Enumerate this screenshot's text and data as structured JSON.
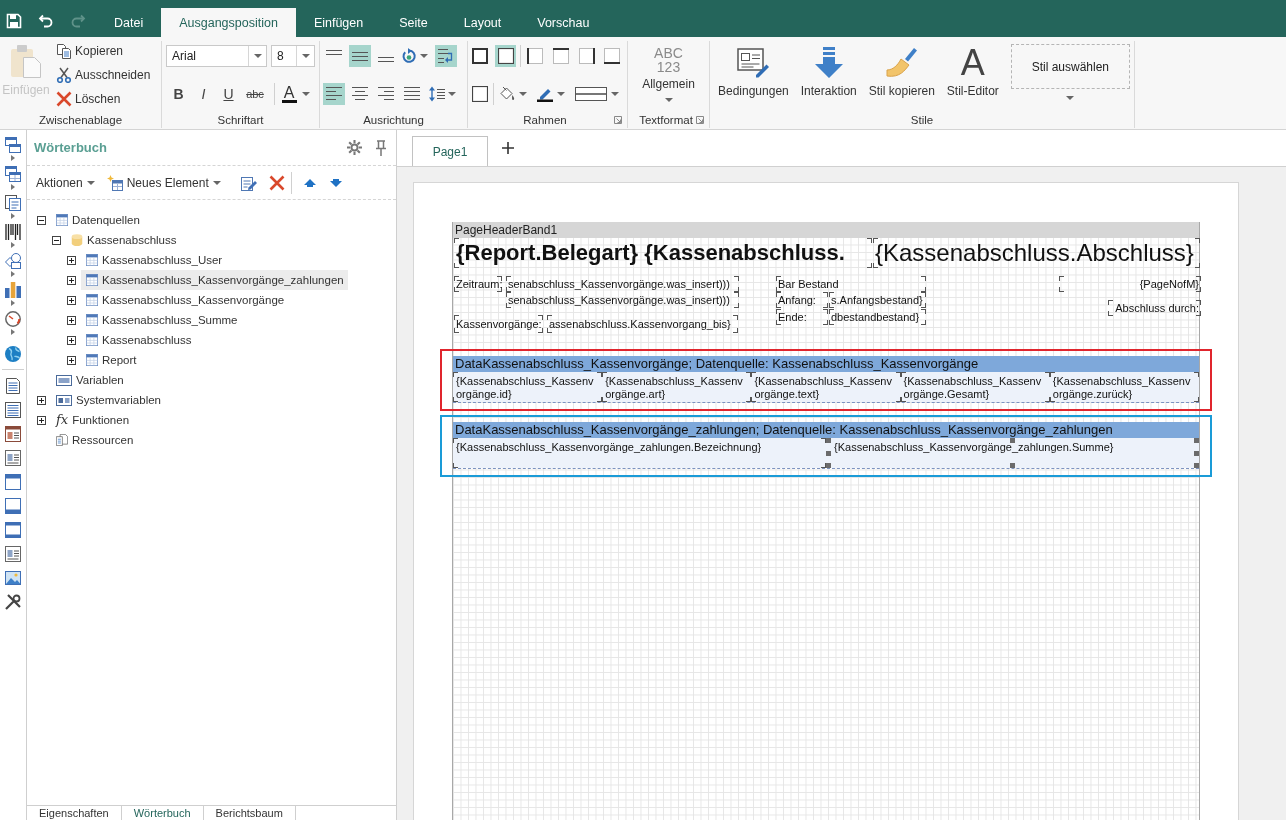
{
  "quick_access": [
    {
      "disabled": false
    },
    {
      "disabled": false
    },
    {
      "disabled": true
    }
  ],
  "tabs": [
    {
      "label": "Datei",
      "selected": false
    },
    {
      "label": "Ausgangsposition",
      "selected": true
    },
    {
      "label": "Einfügen",
      "selected": false
    },
    {
      "label": "Seite",
      "selected": false
    },
    {
      "label": "Layout",
      "selected": false
    },
    {
      "label": "Vorschau",
      "selected": false
    }
  ],
  "ribbon": {
    "clipboard": {
      "title": "Zwischenablage",
      "paste": {
        "label": "Einfügen",
        "disabled": true
      },
      "items": [
        {
          "label": "Kopieren",
          "disabled": false
        },
        {
          "label": "Ausschneiden",
          "disabled": false
        },
        {
          "label": "Löschen",
          "disabled": false
        }
      ]
    },
    "font": {
      "title": "Schriftart",
      "family": "Arial",
      "size": "8",
      "styles": [
        {
          "label": "B",
          "selected": false
        },
        {
          "label": "I",
          "selected": false
        },
        {
          "label": "U",
          "selected": false
        },
        {
          "label": "abc",
          "selected": false
        }
      ],
      "color_glyph": "A"
    },
    "alignment": {
      "title": "Ausrichtung",
      "vertical": [
        {
          "selected": false
        },
        {
          "selected": true
        },
        {
          "selected": false
        }
      ],
      "word_wrap": {
        "selected": true
      },
      "horizontal": [
        {
          "selected": true
        },
        {
          "selected": false
        },
        {
          "selected": false
        },
        {
          "selected": false
        }
      ]
    },
    "borders": {
      "title": "Rahmen",
      "sides": [
        {
          "selected": false
        },
        {
          "selected": true
        },
        {
          "selected": false
        },
        {
          "selected": false
        },
        {
          "selected": false
        },
        {
          "selected": false
        }
      ]
    },
    "text_format": {
      "title": "Textformat",
      "sample": [
        "ABC",
        "123"
      ],
      "value": "Allgemein"
    },
    "styles": {
      "title": "Stile",
      "buttons": [
        {
          "kind": "conditions",
          "label": "Bedingungen"
        },
        {
          "kind": "interaction",
          "label": "Interaktion"
        },
        {
          "kind": "copy_style",
          "label": "Stil kopieren"
        },
        {
          "kind": "style_editor",
          "label": "Stil-Editor",
          "glyph": "A"
        }
      ],
      "picker": "Stil auswählen"
    }
  },
  "dictionary_panel": {
    "title": "Wörterbuch",
    "toolbar": [
      {
        "kind": "menu",
        "label": "Aktionen"
      },
      {
        "kind": "new",
        "label": "Neues Element"
      }
    ],
    "tree": [
      {
        "label": "Datenquellen",
        "kind": "table",
        "expanded": true,
        "selected": false,
        "children": [
          {
            "label": "Kassenabschluss",
            "kind": "database",
            "expanded": true,
            "selected": false,
            "children": [
              {
                "label": "Kassenabschluss_User",
                "kind": "table",
                "expanded": false,
                "selected": false
              },
              {
                "label": "Kassenabschluss_Kassenvorgänge_zahlungen",
                "kind": "table",
                "expanded": false,
                "selected": true
              },
              {
                "label": "Kassenabschluss_Kassenvorgänge",
                "kind": "table",
                "expanded": false,
                "selected": false
              },
              {
                "label": "Kassenabschluss_Summe",
                "kind": "table",
                "expanded": false,
                "selected": false
              },
              {
                "label": "Kassenabschluss",
                "kind": "table",
                "expanded": false,
                "selected": false
              },
              {
                "label": "Report",
                "kind": "table",
                "expanded": false,
                "selected": false
              }
            ]
          }
        ]
      },
      {
        "label": "Variablen",
        "kind": "variables",
        "selected": false
      },
      {
        "label": "Systemvariablen",
        "kind": "system_variables",
        "expanded": false,
        "selected": false
      },
      {
        "label": "Funktionen",
        "kind": "functions",
        "glyph": "fx",
        "expanded": false,
        "selected": false
      },
      {
        "label": "Ressourcen",
        "kind": "resources",
        "selected": false
      }
    ],
    "bottom_tabs": [
      {
        "label": "Eigenschaften",
        "selected": false
      },
      {
        "label": "Wörterbuch",
        "selected": true
      },
      {
        "label": "Berichtsbaum",
        "selected": false
      }
    ]
  },
  "designer": {
    "page_tabs": [
      {
        "label": "Page1",
        "selected": true
      }
    ],
    "header_band": {
      "title": "PageHeaderBand1",
      "components": [
        {
          "kind": "title_bold",
          "text": "{Report.Belegart} {Kassenabschluss."
        },
        {
          "kind": "title",
          "text": "{Kassenabschluss.Abschluss}"
        },
        {
          "kind": "text",
          "text": "Zeitraum:"
        },
        {
          "kind": "text",
          "text": "senabschluss_Kassenvorgänge.was_insert)))"
        },
        {
          "kind": "text",
          "text": "senabschluss_Kassenvorgänge.was_insert)))"
        },
        {
          "kind": "text",
          "text": "Kassenvorgänge:"
        },
        {
          "kind": "text",
          "text": "assenabschluss.Kassenvorgang_bis}"
        },
        {
          "kind": "text",
          "text": "Bar Bestand"
        },
        {
          "kind": "text",
          "text": "Anfang:"
        },
        {
          "kind": "text",
          "text": "s.Anfangsbestand}"
        },
        {
          "kind": "text",
          "text": "Ende:"
        },
        {
          "kind": "text",
          "text": "dbestandbestand}"
        },
        {
          "kind": "text",
          "text": "{PageNofM}"
        },
        {
          "kind": "text",
          "text": "Abschluss durch:"
        }
      ]
    },
    "data_bands": [
      {
        "title": "DataKassenabschluss_Kassenvorgänge; Datenquelle: Kassenabschluss_Kassenvorgänge",
        "color": "#e0252d",
        "cells": [
          {
            "text": "{Kassenabschluss_Kassenvorgänge.id}",
            "selected": false
          },
          {
            "text": "{Kassenabschluss_Kassenvorgänge.art}",
            "selected": false
          },
          {
            "text": "{Kassenabschluss_Kassenvorgänge.text}",
            "selected": false
          },
          {
            "text": "{Kassenabschluss_Kassenvorgänge.Gesamt}",
            "selected": false
          },
          {
            "text": "{Kassenabschluss_Kassenvorgänge.zurück}",
            "selected": false
          }
        ]
      },
      {
        "title": "DataKassenabschluss_Kassenvorgänge_zahlungen; Datenquelle: Kassenabschluss_Kassenvorgänge_zahlungen",
        "color": "#1a9bd7",
        "cells": [
          {
            "text": "{Kassenabschluss_Kassenvorgänge_zahlungen.Bezeichnung}",
            "selected": false
          },
          {
            "text": "{Kassenabschluss_Kassenvorgänge_zahlungen.Summe}",
            "selected": true
          }
        ]
      }
    ]
  }
}
